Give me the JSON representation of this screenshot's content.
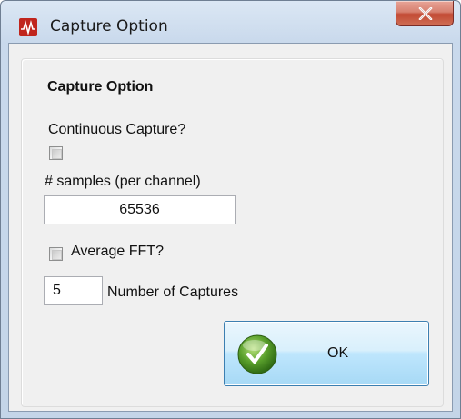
{
  "window": {
    "title": "Capture Option",
    "icon": "app-waveform-icon",
    "close_icon": "close-icon"
  },
  "dialog": {
    "heading": "Capture Option",
    "continuous_capture": {
      "label": "Continuous Capture?",
      "checked": false
    },
    "samples": {
      "label": "# samples (per channel)",
      "value": "65536"
    },
    "average_fft": {
      "label": "Average FFT?",
      "checked": false
    },
    "captures": {
      "value": "5",
      "label": "Number of Captures"
    },
    "ok_button": {
      "label": "OK",
      "icon": "checkmark-icon"
    }
  },
  "colors": {
    "accent": "#3c7fb1",
    "ok_icon_green": "#5aa02c",
    "close_red": "#c24a34",
    "app_icon_red": "#c0251d"
  }
}
